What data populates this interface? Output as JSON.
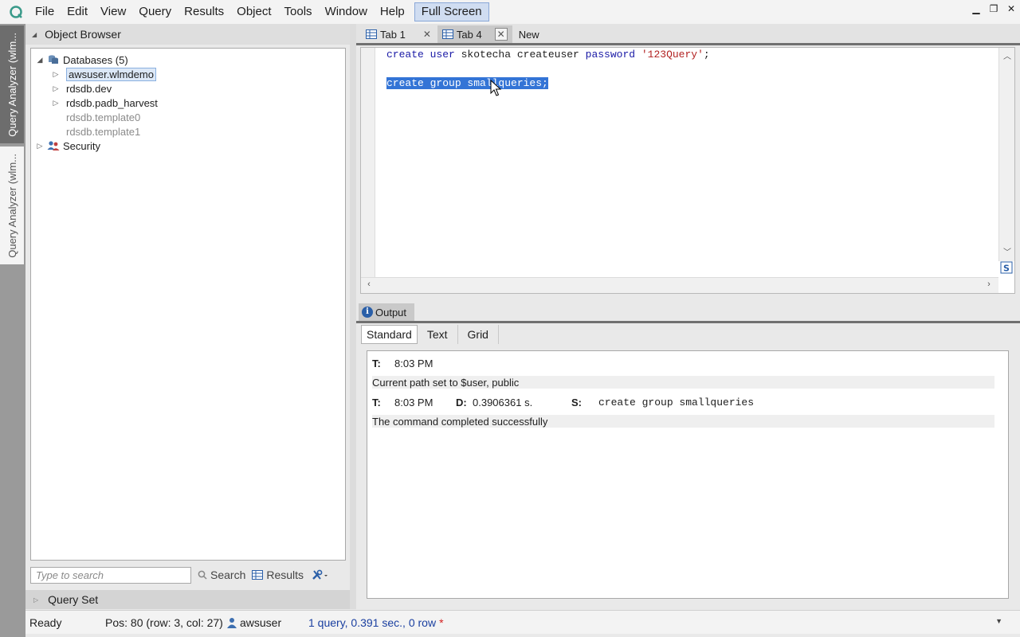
{
  "menu": {
    "items": [
      "File",
      "Edit",
      "View",
      "Query",
      "Results",
      "Object",
      "Tools",
      "Window",
      "Help"
    ],
    "fullscreen_label": "Full Screen"
  },
  "vertical_tabs": [
    "Query Analyzer (wlm...",
    "Query Analyzer (wlm..."
  ],
  "object_browser": {
    "title": "Object Browser",
    "databases_label": "Databases (5)",
    "db_items": [
      "awsuser.wlmdemo",
      "rdsdb.dev",
      "rdsdb.padb_harvest",
      "rdsdb.template0",
      "rdsdb.template1"
    ],
    "security_label": "Security",
    "search_placeholder": "Type to search",
    "search_button": "Search",
    "results_button": "Results"
  },
  "query_set_label": "Query Set",
  "tabs": [
    {
      "label": "Tab 1"
    },
    {
      "label": "Tab 4"
    },
    {
      "label": "New"
    }
  ],
  "editor": {
    "line1": {
      "kw1": "create user",
      "mid": " skotecha createuser ",
      "kw2": "password",
      "str": " '123Query'",
      "end": ";"
    },
    "line3": "create group smallqueries;"
  },
  "output": {
    "tab_label": "Output",
    "subtabs": [
      "Standard",
      "Text",
      "Grid"
    ],
    "row1": {
      "t_label": "T:",
      "time": "8:03 PM"
    },
    "msg1": "Current path set to $user, public",
    "row2": {
      "t_label": "T:",
      "time": "8:03 PM",
      "d_label": "D:",
      "duration": "0.3906361 s.",
      "s_label": "S:",
      "statement": "create group smallqueries"
    },
    "msg2": "The command completed successfully"
  },
  "status": {
    "ready": "Ready",
    "pos": "Pos: 80 (row: 3, col: 27)",
    "user": "awsuser",
    "stats": "1 query, 0.391 sec., 0 row",
    "modified": "*"
  }
}
